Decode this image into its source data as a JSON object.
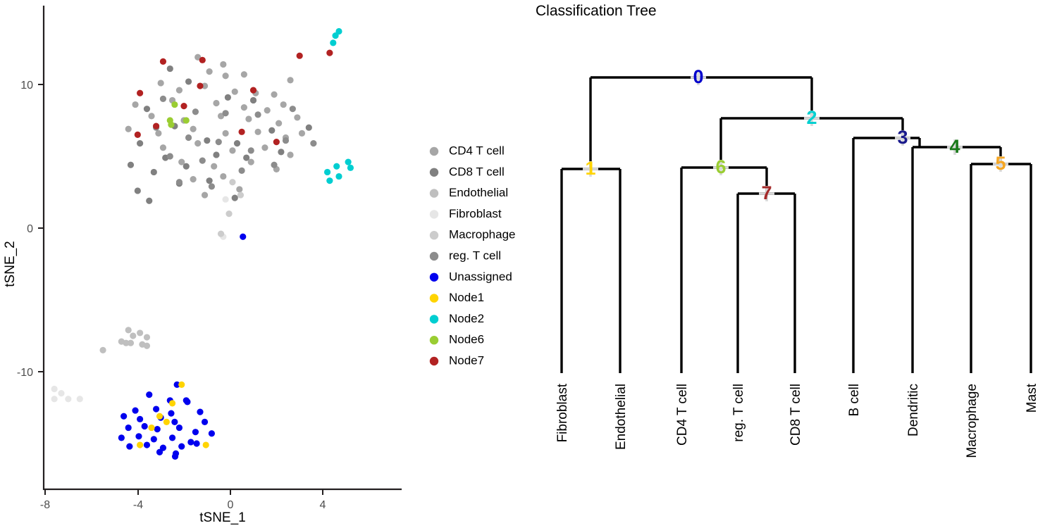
{
  "scatter": {
    "x_axis": {
      "label": "tSNE_1",
      "ticks": [
        -8,
        -4,
        0,
        4
      ],
      "range": [
        -8.9,
        6.5
      ]
    },
    "y_axis": {
      "label": "tSNE_2",
      "ticks": [
        10,
        0,
        -10
      ],
      "range": [
        -16.6,
        14.0
      ]
    },
    "legend": {
      "items": [
        {
          "label": "CD4 T cell",
          "color": "#a6a6a6"
        },
        {
          "label": "CD8 T cell",
          "color": "#808080"
        },
        {
          "label": "Endothelial",
          "color": "#bfbfbf"
        },
        {
          "label": "Fibroblast",
          "color": "#e6e6e6"
        },
        {
          "label": "Macrophage",
          "color": "#cccccc"
        },
        {
          "label": "reg. T cell",
          "color": "#8c8c8c"
        },
        {
          "label": "Unassigned",
          "color": "#0000ee"
        },
        {
          "label": "Node1",
          "color": "#ffd400"
        },
        {
          "label": "Node2",
          "color": "#00ced1"
        },
        {
          "label": "Node6",
          "color": "#9acd32"
        },
        {
          "label": "Node7",
          "color": "#b22222"
        }
      ]
    }
  },
  "chart_data": {
    "type": "scatter",
    "title": "",
    "xlabel": "tSNE_1",
    "ylabel": "tSNE_2",
    "xlim": [
      -8.9,
      6.5
    ],
    "ylim": [
      -16.6,
      14.0
    ],
    "grid": false,
    "legend_position": "right",
    "series": [
      {
        "name": "CD4 T cell",
        "color": "#a6a6a6",
        "points": [
          [
            -1.4,
            11.9
          ],
          [
            -0.3,
            11.4
          ],
          [
            -0.9,
            10.9
          ],
          [
            -0.2,
            10.6
          ],
          [
            0.6,
            10.7
          ],
          [
            2.6,
            10.3
          ],
          [
            -3.0,
            10.1
          ],
          [
            -2.2,
            9.6
          ],
          [
            -1.1,
            9.9
          ],
          [
            0.2,
            9.5
          ],
          [
            1.1,
            9.4
          ],
          [
            1.9,
            9.3
          ],
          [
            -4.1,
            8.6
          ],
          [
            -2.5,
            8.9
          ],
          [
            -0.6,
            8.7
          ],
          [
            0.6,
            8.4
          ],
          [
            1.6,
            8.2
          ],
          [
            2.3,
            8.6
          ],
          [
            -3.4,
            7.8
          ],
          [
            -2.0,
            7.5
          ],
          [
            -0.4,
            7.8
          ],
          [
            0.8,
            7.6
          ],
          [
            2.1,
            7.3
          ],
          [
            2.9,
            7.7
          ],
          [
            -4.4,
            6.9
          ],
          [
            -3.1,
            6.6
          ],
          [
            -1.6,
            6.9
          ],
          [
            -0.2,
            6.6
          ],
          [
            1.2,
            6.7
          ],
          [
            2.4,
            6.3
          ],
          [
            3.1,
            6.6
          ],
          [
            -2.9,
            5.6
          ],
          [
            -1.4,
            5.9
          ],
          [
            0.1,
            5.4
          ],
          [
            1.5,
            5.6
          ],
          [
            2.6,
            5.1
          ],
          [
            -2.1,
            4.6
          ],
          [
            -0.7,
            4.3
          ],
          [
            0.9,
            4.6
          ],
          [
            2.0,
            4.1
          ],
          [
            -1.6,
            3.4
          ],
          [
            -0.3,
            3.6
          ],
          [
            0.4,
            2.7
          ],
          [
            -1.1,
            2.3
          ]
        ]
      },
      {
        "name": "CD8 T cell",
        "color": "#808080",
        "points": [
          [
            -2.6,
            11.1
          ],
          [
            -1.8,
            10.2
          ],
          [
            -0.1,
            9.1
          ],
          [
            1.0,
            8.9
          ],
          [
            -3.6,
            8.3
          ],
          [
            -2.4,
            7.1
          ],
          [
            -1.0,
            6.1
          ],
          [
            0.3,
            5.9
          ],
          [
            1.8,
            6.8
          ],
          [
            3.4,
            7.0
          ],
          [
            -3.9,
            5.9
          ],
          [
            -2.8,
            4.9
          ],
          [
            -1.9,
            4.3
          ],
          [
            -0.6,
            5.1
          ],
          [
            0.7,
            4.9
          ],
          [
            2.2,
            5.3
          ],
          [
            -4.3,
            4.4
          ],
          [
            -3.3,
            3.9
          ],
          [
            -2.2,
            3.1
          ],
          [
            -0.9,
            3.3
          ],
          [
            0.2,
            2.1
          ],
          [
            -4.0,
            2.6
          ],
          [
            -3.5,
            1.9
          ]
        ]
      },
      {
        "name": "Endothelial",
        "color": "#bfbfbf",
        "points": [
          [
            -4.4,
            -7.1
          ],
          [
            -4.2,
            -7.5
          ],
          [
            -3.9,
            -7.3
          ],
          [
            -3.6,
            -7.6
          ],
          [
            -4.7,
            -7.9
          ],
          [
            -4.5,
            -8.0
          ],
          [
            -4.3,
            -8.0
          ],
          [
            -3.8,
            -8.1
          ],
          [
            -3.6,
            -8.2
          ],
          [
            -5.5,
            -8.5
          ]
        ]
      },
      {
        "name": "Fibroblast",
        "color": "#e6e6e6",
        "points": [
          [
            -7.6,
            -11.2
          ],
          [
            -7.3,
            -11.5
          ],
          [
            -7.6,
            -11.9
          ],
          [
            -7.0,
            -11.9
          ],
          [
            -6.5,
            -11.9
          ],
          [
            -0.2,
            2.0
          ],
          [
            -0.3,
            -0.6
          ]
        ]
      },
      {
        "name": "Macrophage",
        "color": "#cccccc",
        "points": [
          [
            0.1,
            3.2
          ],
          [
            0.45,
            2.3
          ],
          [
            -0.05,
            1.0
          ],
          [
            -0.4,
            -0.4
          ]
        ]
      },
      {
        "name": "reg. T cell",
        "color": "#8c8c8c",
        "points": [
          [
            -2.9,
            9.0
          ],
          [
            -1.5,
            8.1
          ],
          [
            -0.2,
            8.0
          ],
          [
            1.2,
            7.9
          ],
          [
            2.7,
            8.3
          ],
          [
            -3.2,
            7.0
          ],
          [
            -1.8,
            6.3
          ],
          [
            -0.5,
            6.0
          ],
          [
            0.9,
            5.4
          ],
          [
            2.4,
            6.1
          ],
          [
            3.6,
            5.9
          ],
          [
            -2.6,
            5.0
          ],
          [
            -1.2,
            4.7
          ],
          [
            0.5,
            4.0
          ],
          [
            1.9,
            4.4
          ],
          [
            -2.2,
            3.2
          ],
          [
            -0.8,
            2.9
          ]
        ]
      },
      {
        "name": "Unassigned",
        "color": "#0000ee",
        "points": [
          [
            -2.3,
            -10.9
          ],
          [
            -3.5,
            -11.6
          ],
          [
            -2.6,
            -12.0
          ],
          [
            -1.9,
            -12.0
          ],
          [
            -1.85,
            -12.1
          ],
          [
            -4.1,
            -12.7
          ],
          [
            -3.2,
            -12.6
          ],
          [
            -2.55,
            -12.9
          ],
          [
            -1.3,
            -12.8
          ],
          [
            -4.6,
            -13.1
          ],
          [
            -3.9,
            -13.3
          ],
          [
            -3.0,
            -13.2
          ],
          [
            -2.4,
            -13.5
          ],
          [
            -1.1,
            -13.5
          ],
          [
            -4.4,
            -13.9
          ],
          [
            -3.7,
            -13.8
          ],
          [
            -3.15,
            -14.0
          ],
          [
            -2.2,
            -13.9
          ],
          [
            -1.5,
            -14.2
          ],
          [
            -0.8,
            -14.3
          ],
          [
            -4.7,
            -14.6
          ],
          [
            -3.95,
            -14.5
          ],
          [
            -3.3,
            -14.7
          ],
          [
            -2.5,
            -14.6
          ],
          [
            -1.7,
            -14.9
          ],
          [
            -4.35,
            -15.2
          ],
          [
            -3.6,
            -15.1
          ],
          [
            -2.9,
            -15.3
          ],
          [
            -2.1,
            -15.2
          ],
          [
            -1.45,
            -15.0
          ],
          [
            -3.05,
            -15.6
          ],
          [
            -2.35,
            -15.7
          ],
          [
            -2.38,
            -15.9
          ],
          [
            0.55,
            -0.6
          ]
        ]
      },
      {
        "name": "Node1",
        "color": "#ffd400",
        "points": [
          [
            -2.1,
            -10.9
          ],
          [
            -2.5,
            -12.2
          ],
          [
            -3.05,
            -13.1
          ],
          [
            -2.75,
            -13.5
          ],
          [
            -3.4,
            -13.9
          ],
          [
            -3.9,
            -15.1
          ],
          [
            -1.05,
            -15.1
          ]
        ]
      },
      {
        "name": "Node2",
        "color": "#00ced1",
        "points": [
          [
            4.55,
            13.4
          ],
          [
            4.7,
            13.7
          ],
          [
            4.45,
            12.9
          ],
          [
            4.2,
            3.9
          ],
          [
            4.6,
            4.3
          ],
          [
            5.1,
            4.6
          ],
          [
            4.3,
            3.3
          ],
          [
            4.7,
            3.6
          ],
          [
            5.2,
            4.2
          ]
        ]
      },
      {
        "name": "Node6",
        "color": "#9acd32",
        "points": [
          [
            -2.4,
            8.6
          ],
          [
            -2.6,
            7.5
          ],
          [
            -1.9,
            7.5
          ],
          [
            -2.55,
            7.2
          ]
        ]
      },
      {
        "name": "Node7",
        "color": "#b22222",
        "points": [
          [
            -2.9,
            11.6
          ],
          [
            -1.2,
            11.7
          ],
          [
            3.0,
            12.0
          ],
          [
            4.3,
            12.2
          ],
          [
            -3.9,
            9.4
          ],
          [
            -1.3,
            9.9
          ],
          [
            1.0,
            9.6
          ],
          [
            -2.0,
            8.5
          ],
          [
            -3.2,
            7.1
          ],
          [
            -4.0,
            6.5
          ],
          [
            0.5,
            6.7
          ],
          [
            2.0,
            6.0
          ]
        ]
      }
    ]
  },
  "tree": {
    "title": "Classification Tree",
    "leaves": [
      {
        "label": "Fibroblast"
      },
      {
        "label": "Endothelial"
      },
      {
        "label": "CD4 T cell"
      },
      {
        "label": "reg. T cell"
      },
      {
        "label": "CD8 T cell"
      },
      {
        "label": "B cell"
      },
      {
        "label": "Dendritic"
      },
      {
        "label": "Macrophage"
      },
      {
        "label": "Mast"
      }
    ],
    "nodes": [
      {
        "id": "0",
        "label": "0",
        "color": "#0000cc"
      },
      {
        "id": "1",
        "label": "1",
        "color": "#ffd400"
      },
      {
        "id": "2",
        "label": "2",
        "color": "#00d0d0"
      },
      {
        "id": "3",
        "label": "3",
        "color": "#1a1a8c"
      },
      {
        "id": "4",
        "label": "4",
        "color": "#1a7a1a"
      },
      {
        "id": "5",
        "label": "5",
        "color": "#f5a623"
      },
      {
        "id": "6",
        "label": "6",
        "color": "#9acd32"
      },
      {
        "id": "7",
        "label": "7",
        "color": "#a52a2a"
      }
    ]
  }
}
